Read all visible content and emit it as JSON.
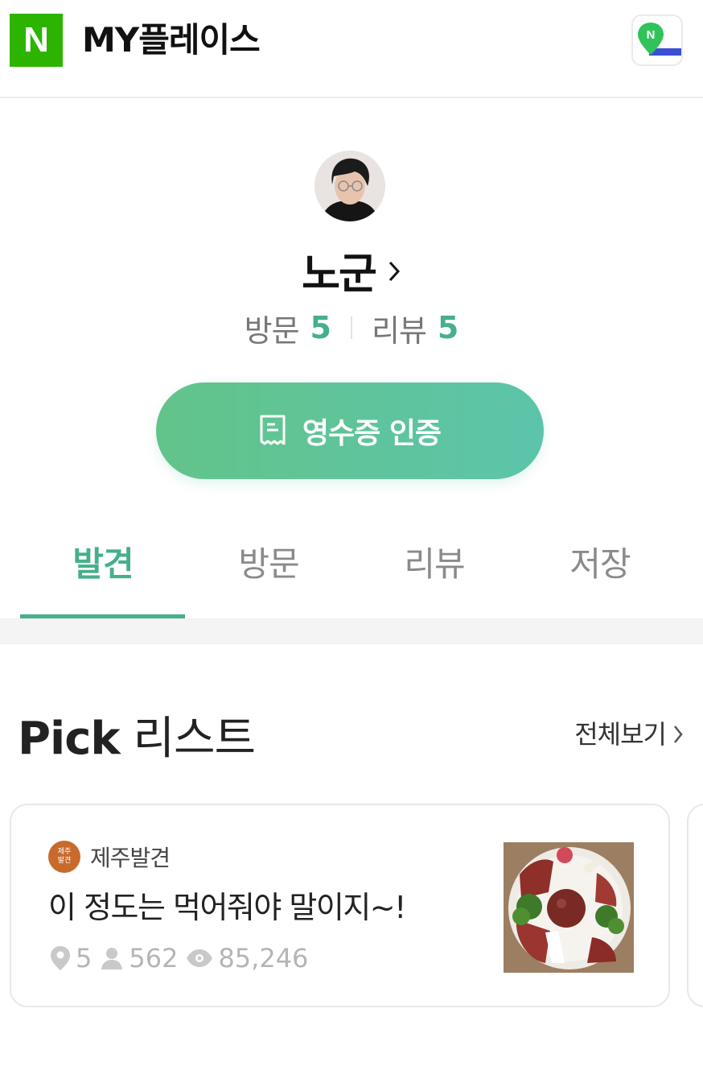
{
  "header": {
    "logo_letter": "N",
    "title": "MY플레이스",
    "brand_color": "#2db400"
  },
  "profile": {
    "nickname": "노군",
    "stats": [
      {
        "label": "방문",
        "value": "5"
      },
      {
        "label": "리뷰",
        "value": "5"
      }
    ],
    "receipt_button_label": "영수증 인증",
    "accent_color": "#45b089"
  },
  "tabs": [
    {
      "label": "발견",
      "active": true
    },
    {
      "label": "방문",
      "active": false
    },
    {
      "label": "리뷰",
      "active": false
    },
    {
      "label": "저장",
      "active": false
    }
  ],
  "pick_list": {
    "title_bold": "Pick",
    "title_rest": " 리스트",
    "see_all_label": "전체보기",
    "cards": [
      {
        "badge_icon_text": [
          "제주",
          "발견"
        ],
        "badge_label": "제주발견",
        "title": "이 정도는 먹어줘야 말이지~!",
        "places": "5",
        "followers": "562",
        "views": "85,246"
      }
    ]
  },
  "icons": [
    "map-app-icon",
    "chevron-right-icon",
    "receipt-icon",
    "location-pin-icon",
    "person-icon",
    "eye-icon"
  ]
}
